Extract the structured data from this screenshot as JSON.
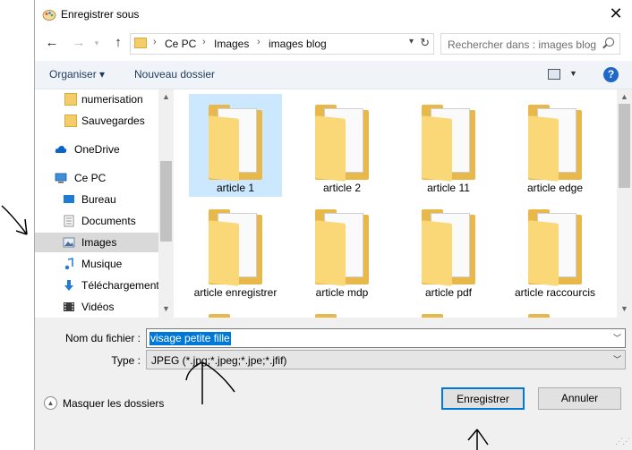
{
  "window": {
    "title": "Enregistrer sous",
    "close_glyph": "✕"
  },
  "nav": {
    "back": "←",
    "forward": "→",
    "up": "↑"
  },
  "address": {
    "crumbs": [
      "Ce PC",
      "Images",
      "images blog"
    ],
    "separator": "›"
  },
  "search": {
    "placeholder": "Rechercher dans : images blog"
  },
  "toolbar": {
    "organize": "Organiser ▾",
    "new_folder": "Nouveau dossier",
    "help": "?"
  },
  "sidebar": {
    "items": [
      {
        "label": "numerisation",
        "icon": "folder-icon"
      },
      {
        "label": "Sauvegardes",
        "icon": "folder-icon"
      },
      {
        "label": "OneDrive",
        "icon": "cloud-icon"
      },
      {
        "label": "Ce PC",
        "icon": "computer-icon"
      },
      {
        "label": "Bureau",
        "icon": "desktop-icon"
      },
      {
        "label": "Documents",
        "icon": "documents-icon"
      },
      {
        "label": "Images",
        "icon": "pictures-icon",
        "selected": true
      },
      {
        "label": "Musique",
        "icon": "music-icon"
      },
      {
        "label": "Téléchargement",
        "icon": "download-icon"
      },
      {
        "label": "Vidéos",
        "icon": "videos-icon"
      }
    ]
  },
  "files": [
    {
      "name": "article 1",
      "selected": true
    },
    {
      "name": "article 2"
    },
    {
      "name": "article 11"
    },
    {
      "name": "article edge"
    },
    {
      "name": "article enregistrer"
    },
    {
      "name": "article mdp"
    },
    {
      "name": "article pdf"
    },
    {
      "name": "article raccourcis"
    }
  ],
  "form": {
    "filename_label": "Nom du fichier :",
    "filename_value": "visage petite fille",
    "type_label": "Type :",
    "type_value": "JPEG (*.jpg;*.jpeg;*.jpe;*.jfif)"
  },
  "footer": {
    "hide_folders": "Masquer les dossiers",
    "save": "Enregistrer",
    "cancel": "Annuler"
  },
  "colors": {
    "accent": "#0078d7",
    "selection": "#cce8ff",
    "folder": "#fbd877"
  }
}
